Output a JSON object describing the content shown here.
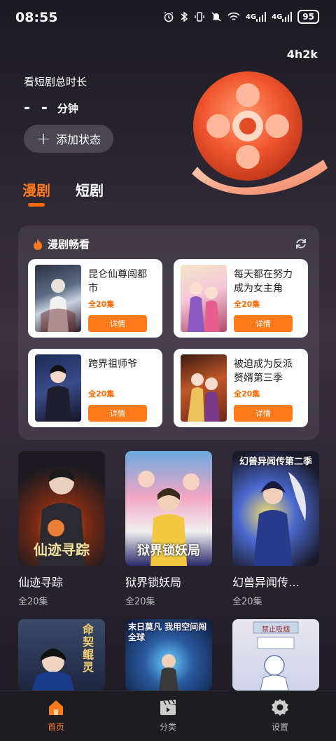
{
  "status_bar": {
    "time": "08:55",
    "battery": "95",
    "signal1": "4G",
    "signal2": "4G"
  },
  "timer": "4h2k",
  "watch": {
    "title": "看短剧总时长",
    "dashes": "- -",
    "unit": "分钟",
    "add_status_label": "添加状态"
  },
  "tabs": [
    {
      "label": "漫剧",
      "active": true
    },
    {
      "label": "短剧",
      "active": false
    }
  ],
  "promo": {
    "title": "漫剧畅看",
    "items": [
      {
        "title": "昆仑仙尊闯都市",
        "eps": "全20集",
        "button": "详情"
      },
      {
        "title": "每天都在努力成为女主角",
        "eps": "全20集",
        "button": "详情"
      },
      {
        "title": "跨界祖师爷",
        "eps": "全20集",
        "button": "详情"
      },
      {
        "title": "被迫成为反派赘婿第三季",
        "eps": "全20集",
        "button": "详情"
      }
    ]
  },
  "grid": [
    {
      "title": "仙迹寻踪",
      "eps": "全20集",
      "cover_text": "仙迹寻踪"
    },
    {
      "title": "狱界锁妖局",
      "eps": "全20集",
      "cover_text": "狱界锁妖局"
    },
    {
      "title": "幻兽异闻传…",
      "eps": "全20集",
      "cover_text": "幻兽异闻传第二季"
    },
    {
      "title": "",
      "eps": "",
      "cover_text": "命契鲲灵"
    },
    {
      "title": "",
      "eps": "",
      "cover_text": "末日莫凡 我用空间闯全球"
    },
    {
      "title": "",
      "eps": "",
      "cover_text": "禁止吸烟"
    }
  ],
  "bottom_nav": [
    {
      "label": "首页",
      "icon": "home-icon",
      "active": true
    },
    {
      "label": "分类",
      "icon": "clapperboard-icon",
      "active": false
    },
    {
      "label": "设置",
      "icon": "gear-icon",
      "active": false
    }
  ],
  "colors": {
    "accent": "#ff7a1a",
    "background": "#2a2530"
  }
}
